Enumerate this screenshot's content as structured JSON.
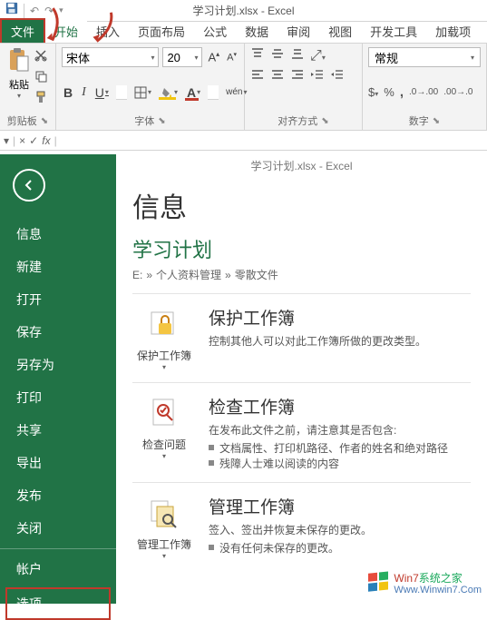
{
  "title": "学习计划.xlsx - Excel",
  "tabs": {
    "file": "文件",
    "home": "开始",
    "insert": "插入",
    "layout": "页面布局",
    "formulas": "公式",
    "data": "数据",
    "review": "审阅",
    "view": "视图",
    "dev": "开发工具",
    "addin": "加载项"
  },
  "ribbon": {
    "clipboard": {
      "paste": "粘贴",
      "label": "剪贴板"
    },
    "font": {
      "name": "宋体",
      "size": "20",
      "label": "字体",
      "wen": "wén",
      "bold": "B",
      "italic": "I",
      "underline": "U"
    },
    "align": {
      "label": "对齐方式"
    },
    "number": {
      "format": "常规",
      "label": "数字"
    }
  },
  "backstage": {
    "title": "学习计划.xlsx - Excel",
    "nav": {
      "info": "信息",
      "new": "新建",
      "open": "打开",
      "save": "保存",
      "saveas": "另存为",
      "print": "打印",
      "share": "共享",
      "export": "导出",
      "publish": "发布",
      "close": "关闭",
      "account": "帐户",
      "options": "选项"
    },
    "main": {
      "h1": "信息",
      "h2": "学习计划",
      "path": {
        "p1": "E:",
        "p2": "个人资料管理",
        "p3": "零散文件",
        "sep": "»"
      },
      "protect": {
        "btn": "保护工作簿",
        "title": "保护工作簿",
        "desc": "控制其他人可以对此工作簿所做的更改类型。"
      },
      "inspect": {
        "btn": "检查问题",
        "title": "检查工作簿",
        "desc": "在发布此文件之前，请注意其是否包含:",
        "b1": "文档属性、打印机路径、作者的姓名和绝对路径",
        "b2": "残障人士难以阅读的内容"
      },
      "manage": {
        "btn": "管理工作簿",
        "title": "管理工作簿",
        "desc": "签入、签出并恢复未保存的更改。",
        "b1": "没有任何未保存的更改。"
      }
    }
  },
  "watermark": {
    "brand_a": "Win7",
    "brand_b": "系统之家",
    "url": "Www.Winwin7.Com"
  }
}
